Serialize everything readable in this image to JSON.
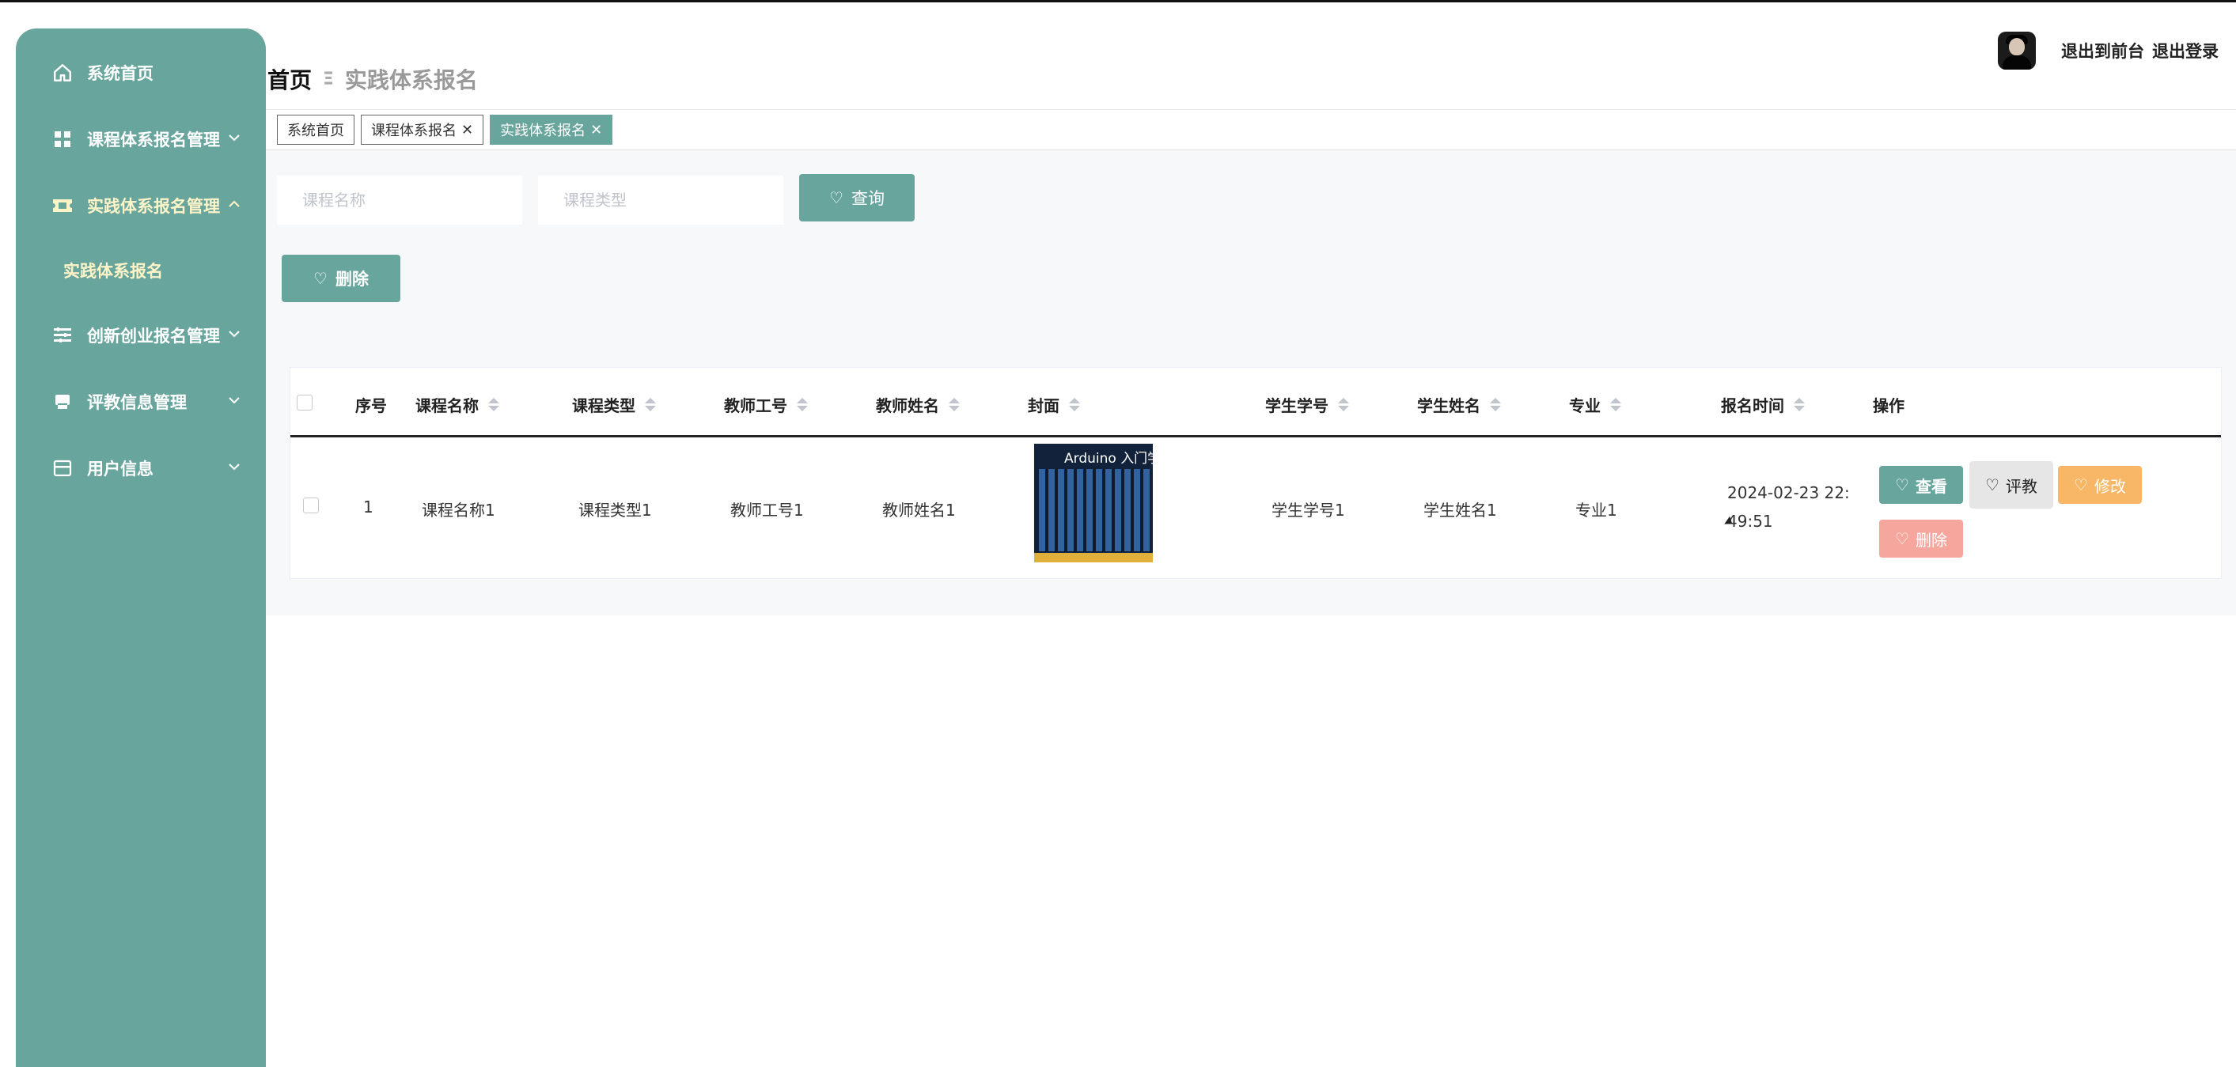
{
  "sidebar": {
    "items": [
      {
        "label": "系统首页",
        "icon": "home-icon"
      },
      {
        "label": "课程体系报名管理",
        "icon": "grid-icon"
      },
      {
        "label": "实践体系报名管理",
        "icon": "ticket-icon"
      },
      {
        "label": "创新创业报名管理",
        "icon": "list-icon"
      },
      {
        "label": "评教信息管理",
        "icon": "printer-icon"
      },
      {
        "label": "用户信息",
        "icon": "card-icon"
      }
    ],
    "sub_item": "实践体系报名"
  },
  "header": {
    "breadcrumb_home": "首页",
    "breadcrumb_sep": "Ξ",
    "breadcrumb_current": "实践体系报名",
    "link_front": "退出到前台",
    "link_logout": "退出登录"
  },
  "tabs": [
    {
      "label": "系统首页"
    },
    {
      "label": "课程体系报名"
    },
    {
      "label": "实践体系报名"
    }
  ],
  "search": {
    "name_placeholder": "课程名称",
    "type_placeholder": "课程类型",
    "query_label": "查询"
  },
  "toolbar": {
    "delete_label": "删除"
  },
  "table": {
    "headers": [
      "序号",
      "课程名称",
      "课程类型",
      "教师工号",
      "教师姓名",
      "封面",
      "学生学号",
      "学生姓名",
      "专业",
      "报名时间",
      "操作"
    ],
    "rows": [
      {
        "index": "1",
        "course_name": "课程名称1",
        "course_type": "课程类型1",
        "teacher_id": "教师工号1",
        "teacher_name": "教师姓名1",
        "cover_title": "Arduino 入门学习套装",
        "student_id": "学生学号1",
        "student_name": "学生姓名1",
        "major": "专业1",
        "time_line1": "2024-02-23 22:",
        "time_line2": "49:51"
      }
    ],
    "actions": {
      "view": "查看",
      "evaluate": "评教",
      "edit": "修改",
      "delete": "删除"
    }
  },
  "colors": {
    "accent": "#68a59c",
    "warning": "#f7b766",
    "danger": "#f6a79d",
    "neutral": "#e6e6e6"
  }
}
